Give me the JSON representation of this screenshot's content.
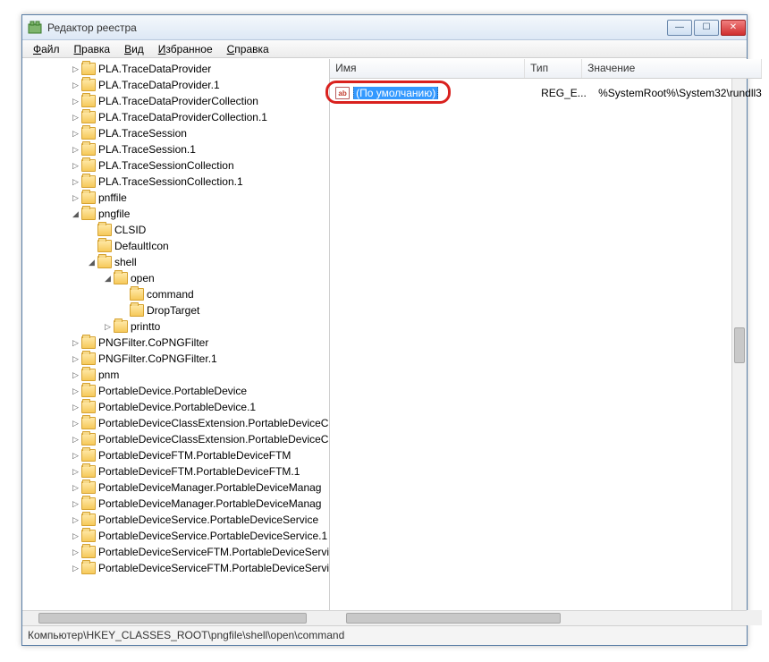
{
  "window": {
    "title": "Редактор реестра"
  },
  "menu": {
    "file": "Файл",
    "edit": "Правка",
    "view": "Вид",
    "favorites": "Избранное",
    "help": "Справка"
  },
  "tree": {
    "items": [
      {
        "indent": 3,
        "exp": "▷",
        "label": "PLA.TraceDataProvider"
      },
      {
        "indent": 3,
        "exp": "▷",
        "label": "PLA.TraceDataProvider.1"
      },
      {
        "indent": 3,
        "exp": "▷",
        "label": "PLA.TraceDataProviderCollection"
      },
      {
        "indent": 3,
        "exp": "▷",
        "label": "PLA.TraceDataProviderCollection.1"
      },
      {
        "indent": 3,
        "exp": "▷",
        "label": "PLA.TraceSession"
      },
      {
        "indent": 3,
        "exp": "▷",
        "label": "PLA.TraceSession.1"
      },
      {
        "indent": 3,
        "exp": "▷",
        "label": "PLA.TraceSessionCollection"
      },
      {
        "indent": 3,
        "exp": "▷",
        "label": "PLA.TraceSessionCollection.1"
      },
      {
        "indent": 3,
        "exp": "▷",
        "label": "pnffile"
      },
      {
        "indent": 3,
        "exp": "◢",
        "label": "pngfile"
      },
      {
        "indent": 4,
        "exp": "",
        "label": "CLSID"
      },
      {
        "indent": 4,
        "exp": "",
        "label": "DefaultIcon"
      },
      {
        "indent": 4,
        "exp": "◢",
        "label": "shell"
      },
      {
        "indent": 5,
        "exp": "◢",
        "label": "open"
      },
      {
        "indent": 6,
        "exp": "",
        "label": "command"
      },
      {
        "indent": 6,
        "exp": "",
        "label": "DropTarget"
      },
      {
        "indent": 5,
        "exp": "▷",
        "label": "printto"
      },
      {
        "indent": 3,
        "exp": "▷",
        "label": "PNGFilter.CoPNGFilter"
      },
      {
        "indent": 3,
        "exp": "▷",
        "label": "PNGFilter.CoPNGFilter.1"
      },
      {
        "indent": 3,
        "exp": "▷",
        "label": "pnm"
      },
      {
        "indent": 3,
        "exp": "▷",
        "label": "PortableDevice.PortableDevice"
      },
      {
        "indent": 3,
        "exp": "▷",
        "label": "PortableDevice.PortableDevice.1"
      },
      {
        "indent": 3,
        "exp": "▷",
        "label": "PortableDeviceClassExtension.PortableDeviceC"
      },
      {
        "indent": 3,
        "exp": "▷",
        "label": "PortableDeviceClassExtension.PortableDeviceC"
      },
      {
        "indent": 3,
        "exp": "▷",
        "label": "PortableDeviceFTM.PortableDeviceFTM"
      },
      {
        "indent": 3,
        "exp": "▷",
        "label": "PortableDeviceFTM.PortableDeviceFTM.1"
      },
      {
        "indent": 3,
        "exp": "▷",
        "label": "PortableDeviceManager.PortableDeviceManag"
      },
      {
        "indent": 3,
        "exp": "▷",
        "label": "PortableDeviceManager.PortableDeviceManag"
      },
      {
        "indent": 3,
        "exp": "▷",
        "label": "PortableDeviceService.PortableDeviceService"
      },
      {
        "indent": 3,
        "exp": "▷",
        "label": "PortableDeviceService.PortableDeviceService.1"
      },
      {
        "indent": 3,
        "exp": "▷",
        "label": "PortableDeviceServiceFTM.PortableDeviceServi"
      },
      {
        "indent": 3,
        "exp": "▷",
        "label": "PortableDeviceServiceFTM.PortableDeviceServi"
      }
    ]
  },
  "list": {
    "columns": {
      "name": "Имя",
      "type": "Тип",
      "value": "Значение"
    },
    "rows": [
      {
        "icon": "ab",
        "name": "(По умолчанию)",
        "type": "REG_E...",
        "value": "%SystemRoot%\\System32\\rundll3",
        "selected": true
      }
    ]
  },
  "status": {
    "path": "Компьютер\\HKEY_CLASSES_ROOT\\pngfile\\shell\\open\\command"
  }
}
